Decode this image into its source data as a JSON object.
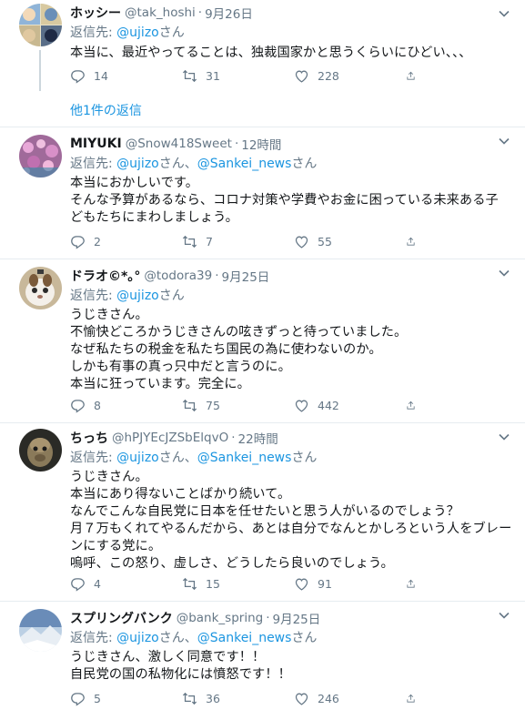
{
  "tweets": [
    {
      "name": "ホッシー",
      "handle": "@tak_hoshi",
      "time": "9月26日",
      "reply_prefix": "返信先: ",
      "mentions": [
        "@ujizo"
      ],
      "reply_suffix": "さん",
      "lines": [
        "本当に、最近やってることは、独裁国家かと思うくらいにひどい、、、"
      ],
      "counts": {
        "reply": "14",
        "retweet": "31",
        "like": "228"
      },
      "more_replies": "他1件の返信"
    },
    {
      "name": "MIYUKI",
      "handle": "@Snow418Sweet",
      "time": "12時間",
      "reply_prefix": "返信先: ",
      "mentions": [
        "@ujizo",
        "@Sankei_news"
      ],
      "reply_mid": "さん、",
      "reply_suffix": "さん",
      "lines": [
        "本当におかしいです。",
        "そんな予算があるなら、コロナ対策や学費やお金に困っている未来ある子",
        "どもたちにまわしましょう。"
      ],
      "counts": {
        "reply": "2",
        "retweet": "7",
        "like": "55"
      }
    },
    {
      "name": "ドラオ©*｡°",
      "handle": "@todora39",
      "time": "9月25日",
      "reply_prefix": "返信先: ",
      "mentions": [
        "@ujizo"
      ],
      "reply_suffix": "さん",
      "lines": [
        "うじきさん。",
        "不愉快どころかうじきさんの呟きずっと待っていました。",
        "なぜ私たちの税金を私たち国民の為に使わないのか。",
        "しかも有事の真っ只中だと言うのに。",
        "本当に狂っています。完全に。"
      ],
      "counts": {
        "reply": "8",
        "retweet": "75",
        "like": "442"
      }
    },
    {
      "name": "ちっち",
      "handle": "@hPJYEcJZSbElqvO",
      "time": "22時間",
      "reply_prefix": "返信先: ",
      "mentions": [
        "@ujizo",
        "@Sankei_news"
      ],
      "reply_mid": "さん、",
      "reply_suffix": "さん",
      "lines": [
        "うじきさん。",
        "本当にあり得ないことばかり続いて。",
        "なんでこんな自民党に日本を任せたいと思う人がいるのでしょう？",
        "月７万もくれてやるんだから、あとは自分でなんとかしろという人をブレー",
        "ンにする党に。",
        "嗚呼、この怒り、虚しさ、どうしたら良いのでしょう。"
      ],
      "counts": {
        "reply": "4",
        "retweet": "15",
        "like": "91"
      }
    },
    {
      "name": "スプリングバンク",
      "handle": "@bank_spring",
      "time": "9月25日",
      "reply_prefix": "返信先: ",
      "mentions": [
        "@ujizo",
        "@Sankei_news"
      ],
      "reply_mid": "さん、",
      "reply_suffix": "さん",
      "lines": [
        "うじきさん、激しく同意です！！",
        "自民党の国の私物化には憤怒です！！"
      ],
      "counts": {
        "reply": "5",
        "retweet": "36",
        "like": "246"
      }
    }
  ],
  "icons": {
    "reply": "reply-icon",
    "retweet": "retweet-icon",
    "like": "heart-icon",
    "share": "share-icon",
    "caret": "chevron-down-icon"
  },
  "colors": {
    "link": "#1b95e0",
    "muted": "#657786",
    "text": "#14171a",
    "divider": "#e6ecf0"
  }
}
